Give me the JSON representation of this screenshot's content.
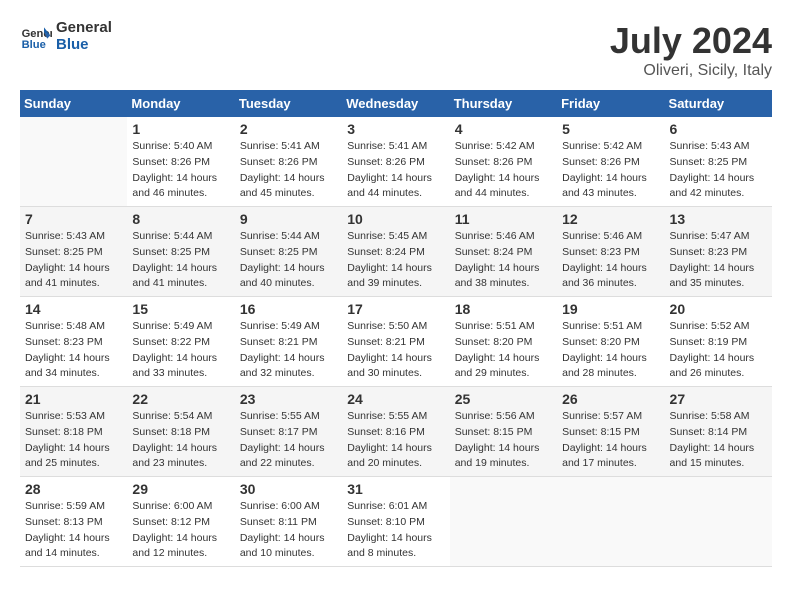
{
  "header": {
    "logo_line1": "General",
    "logo_line2": "Blue",
    "title": "July 2024",
    "subtitle": "Oliveri, Sicily, Italy"
  },
  "weekdays": [
    "Sunday",
    "Monday",
    "Tuesday",
    "Wednesday",
    "Thursday",
    "Friday",
    "Saturday"
  ],
  "weeks": [
    [
      {
        "day": "",
        "sunrise": "",
        "sunset": "",
        "daylight": ""
      },
      {
        "day": "1",
        "sunrise": "Sunrise: 5:40 AM",
        "sunset": "Sunset: 8:26 PM",
        "daylight": "Daylight: 14 hours and 46 minutes."
      },
      {
        "day": "2",
        "sunrise": "Sunrise: 5:41 AM",
        "sunset": "Sunset: 8:26 PM",
        "daylight": "Daylight: 14 hours and 45 minutes."
      },
      {
        "day": "3",
        "sunrise": "Sunrise: 5:41 AM",
        "sunset": "Sunset: 8:26 PM",
        "daylight": "Daylight: 14 hours and 44 minutes."
      },
      {
        "day": "4",
        "sunrise": "Sunrise: 5:42 AM",
        "sunset": "Sunset: 8:26 PM",
        "daylight": "Daylight: 14 hours and 44 minutes."
      },
      {
        "day": "5",
        "sunrise": "Sunrise: 5:42 AM",
        "sunset": "Sunset: 8:26 PM",
        "daylight": "Daylight: 14 hours and 43 minutes."
      },
      {
        "day": "6",
        "sunrise": "Sunrise: 5:43 AM",
        "sunset": "Sunset: 8:25 PM",
        "daylight": "Daylight: 14 hours and 42 minutes."
      }
    ],
    [
      {
        "day": "7",
        "sunrise": "Sunrise: 5:43 AM",
        "sunset": "Sunset: 8:25 PM",
        "daylight": "Daylight: 14 hours and 41 minutes."
      },
      {
        "day": "8",
        "sunrise": "Sunrise: 5:44 AM",
        "sunset": "Sunset: 8:25 PM",
        "daylight": "Daylight: 14 hours and 41 minutes."
      },
      {
        "day": "9",
        "sunrise": "Sunrise: 5:44 AM",
        "sunset": "Sunset: 8:25 PM",
        "daylight": "Daylight: 14 hours and 40 minutes."
      },
      {
        "day": "10",
        "sunrise": "Sunrise: 5:45 AM",
        "sunset": "Sunset: 8:24 PM",
        "daylight": "Daylight: 14 hours and 39 minutes."
      },
      {
        "day": "11",
        "sunrise": "Sunrise: 5:46 AM",
        "sunset": "Sunset: 8:24 PM",
        "daylight": "Daylight: 14 hours and 38 minutes."
      },
      {
        "day": "12",
        "sunrise": "Sunrise: 5:46 AM",
        "sunset": "Sunset: 8:23 PM",
        "daylight": "Daylight: 14 hours and 36 minutes."
      },
      {
        "day": "13",
        "sunrise": "Sunrise: 5:47 AM",
        "sunset": "Sunset: 8:23 PM",
        "daylight": "Daylight: 14 hours and 35 minutes."
      }
    ],
    [
      {
        "day": "14",
        "sunrise": "Sunrise: 5:48 AM",
        "sunset": "Sunset: 8:23 PM",
        "daylight": "Daylight: 14 hours and 34 minutes."
      },
      {
        "day": "15",
        "sunrise": "Sunrise: 5:49 AM",
        "sunset": "Sunset: 8:22 PM",
        "daylight": "Daylight: 14 hours and 33 minutes."
      },
      {
        "day": "16",
        "sunrise": "Sunrise: 5:49 AM",
        "sunset": "Sunset: 8:21 PM",
        "daylight": "Daylight: 14 hours and 32 minutes."
      },
      {
        "day": "17",
        "sunrise": "Sunrise: 5:50 AM",
        "sunset": "Sunset: 8:21 PM",
        "daylight": "Daylight: 14 hours and 30 minutes."
      },
      {
        "day": "18",
        "sunrise": "Sunrise: 5:51 AM",
        "sunset": "Sunset: 8:20 PM",
        "daylight": "Daylight: 14 hours and 29 minutes."
      },
      {
        "day": "19",
        "sunrise": "Sunrise: 5:51 AM",
        "sunset": "Sunset: 8:20 PM",
        "daylight": "Daylight: 14 hours and 28 minutes."
      },
      {
        "day": "20",
        "sunrise": "Sunrise: 5:52 AM",
        "sunset": "Sunset: 8:19 PM",
        "daylight": "Daylight: 14 hours and 26 minutes."
      }
    ],
    [
      {
        "day": "21",
        "sunrise": "Sunrise: 5:53 AM",
        "sunset": "Sunset: 8:18 PM",
        "daylight": "Daylight: 14 hours and 25 minutes."
      },
      {
        "day": "22",
        "sunrise": "Sunrise: 5:54 AM",
        "sunset": "Sunset: 8:18 PM",
        "daylight": "Daylight: 14 hours and 23 minutes."
      },
      {
        "day": "23",
        "sunrise": "Sunrise: 5:55 AM",
        "sunset": "Sunset: 8:17 PM",
        "daylight": "Daylight: 14 hours and 22 minutes."
      },
      {
        "day": "24",
        "sunrise": "Sunrise: 5:55 AM",
        "sunset": "Sunset: 8:16 PM",
        "daylight": "Daylight: 14 hours and 20 minutes."
      },
      {
        "day": "25",
        "sunrise": "Sunrise: 5:56 AM",
        "sunset": "Sunset: 8:15 PM",
        "daylight": "Daylight: 14 hours and 19 minutes."
      },
      {
        "day": "26",
        "sunrise": "Sunrise: 5:57 AM",
        "sunset": "Sunset: 8:15 PM",
        "daylight": "Daylight: 14 hours and 17 minutes."
      },
      {
        "day": "27",
        "sunrise": "Sunrise: 5:58 AM",
        "sunset": "Sunset: 8:14 PM",
        "daylight": "Daylight: 14 hours and 15 minutes."
      }
    ],
    [
      {
        "day": "28",
        "sunrise": "Sunrise: 5:59 AM",
        "sunset": "Sunset: 8:13 PM",
        "daylight": "Daylight: 14 hours and 14 minutes."
      },
      {
        "day": "29",
        "sunrise": "Sunrise: 6:00 AM",
        "sunset": "Sunset: 8:12 PM",
        "daylight": "Daylight: 14 hours and 12 minutes."
      },
      {
        "day": "30",
        "sunrise": "Sunrise: 6:00 AM",
        "sunset": "Sunset: 8:11 PM",
        "daylight": "Daylight: 14 hours and 10 minutes."
      },
      {
        "day": "31",
        "sunrise": "Sunrise: 6:01 AM",
        "sunset": "Sunset: 8:10 PM",
        "daylight": "Daylight: 14 hours and 8 minutes."
      },
      {
        "day": "",
        "sunrise": "",
        "sunset": "",
        "daylight": ""
      },
      {
        "day": "",
        "sunrise": "",
        "sunset": "",
        "daylight": ""
      },
      {
        "day": "",
        "sunrise": "",
        "sunset": "",
        "daylight": ""
      }
    ]
  ]
}
